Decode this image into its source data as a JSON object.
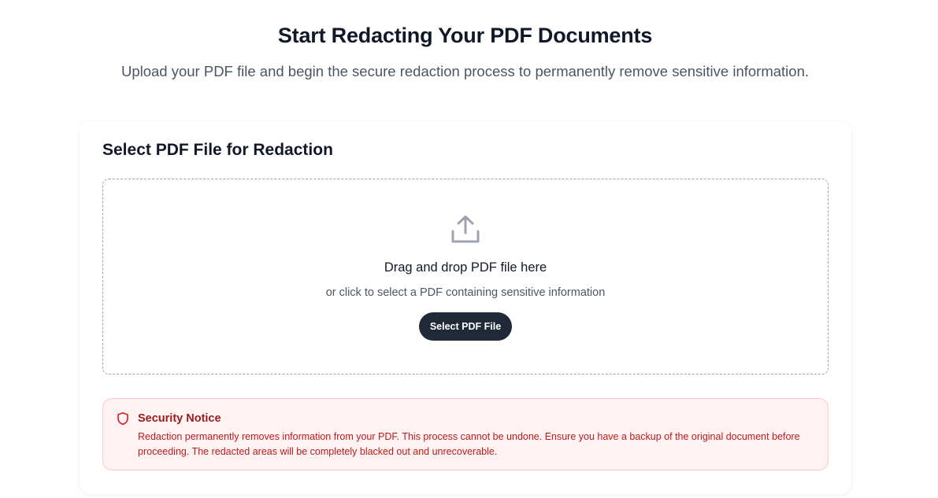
{
  "header": {
    "title": "Start Redacting Your PDF Documents",
    "subtitle": "Upload your PDF file and begin the secure redaction process to permanently remove sensitive information."
  },
  "card": {
    "title": "Select PDF File for Redaction",
    "dropzone": {
      "icon": "upload-icon",
      "title": "Drag and drop PDF file here",
      "subtitle": "or click to select a PDF containing sensitive information",
      "button_label": "Select PDF File"
    },
    "notice": {
      "icon": "shield-icon",
      "title": "Security Notice",
      "text": "Redaction permanently removes information from your PDF. This process cannot be undone. Ensure you have a backup of the original document before proceeding. The redacted areas will be completely blacked out and unrecoverable."
    }
  },
  "colors": {
    "button_bg": "#1f2937",
    "notice_bg": "#fef2f2",
    "notice_border": "#fecaca",
    "notice_title": "#991b1b",
    "notice_text": "#b91c1c"
  }
}
